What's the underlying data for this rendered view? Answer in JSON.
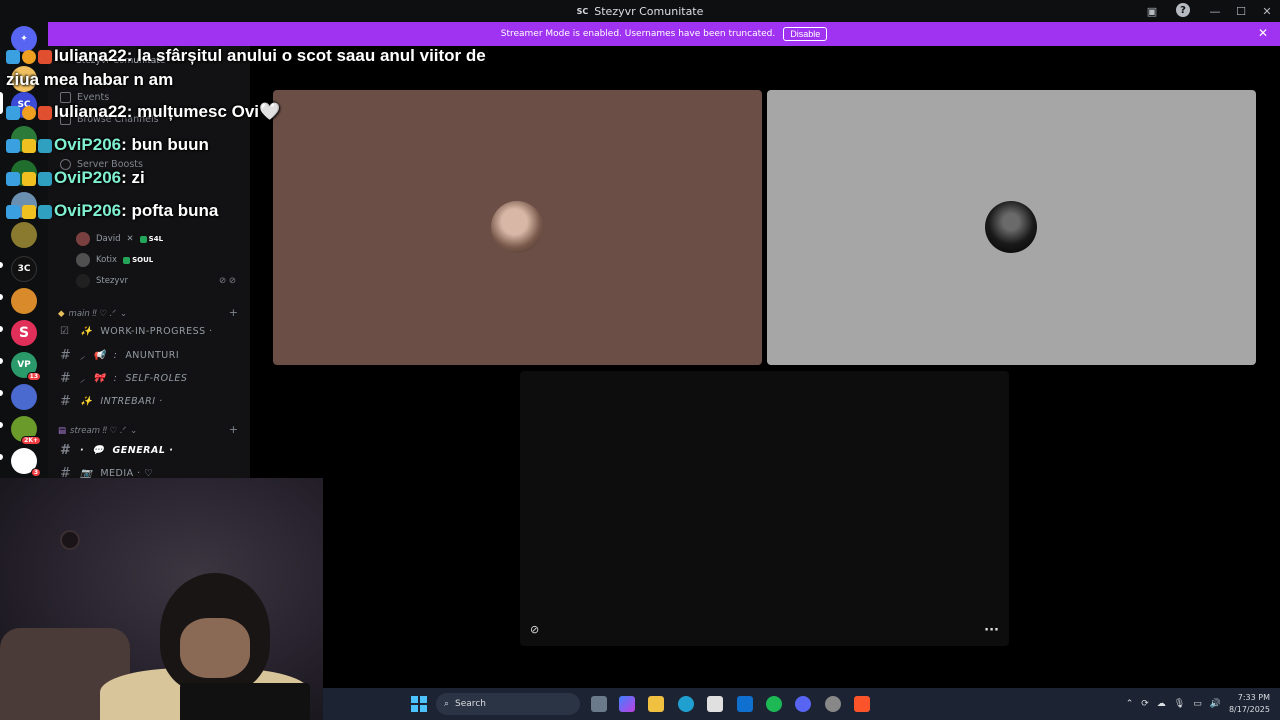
{
  "window": {
    "title": "Stezyvr Comunitate",
    "icon_text": "SC",
    "controls": [
      "minimize-icon",
      "maximize-icon",
      "close-icon"
    ]
  },
  "banner": {
    "message": "Streamer Mode is enabled. Usernames have been truncated.",
    "disable_label": "Disable",
    "color": "#a033f2"
  },
  "server_rail": {
    "items": [
      {
        "label": "",
        "icon": "discord-icon",
        "color": "#5865f2"
      },
      {
        "label": "",
        "badge": "",
        "color": "#f0c060"
      },
      {
        "label": "SC",
        "badge": "",
        "color": "#3b4bd8"
      },
      {
        "label": "",
        "badge": "",
        "color": "#2b7a3a"
      },
      {
        "label": "",
        "badge": "",
        "color": "#1f6e2e"
      },
      {
        "label": "",
        "badge": "",
        "color": "#6b8fb0"
      },
      {
        "label": "",
        "badge": "",
        "color": "#8a7a30"
      },
      {
        "label": "3C",
        "badge": "",
        "color": "#111111"
      },
      {
        "label": "",
        "badge": "",
        "color": "#d98a2a"
      },
      {
        "label": "S",
        "badge": "",
        "color": "#e0305a"
      },
      {
        "label": "VP",
        "badge": "13",
        "color": "#2a9a6a"
      },
      {
        "label": "",
        "badge": "",
        "color": "#4a6ad0"
      },
      {
        "label": "",
        "badge": "2K+",
        "color": "#6a9a2a"
      },
      {
        "label": "",
        "badge": "3",
        "color": "#ffffff"
      }
    ]
  },
  "sidebar": {
    "server_name": "Stezyvr Comunitate",
    "menu": [
      {
        "label": "Events",
        "icon": "calendar-icon"
      },
      {
        "label": "Browse Channels",
        "icon": "browse-icon"
      },
      {
        "label": "Server Boosts",
        "icon": "boost-icon"
      }
    ],
    "voice_users": [
      {
        "name": "David",
        "tag": "S4L",
        "color": "#7a4040"
      },
      {
        "name": "Kotix",
        "tag": "SOUL",
        "color": "#505050"
      },
      {
        "name": "Stezyvr",
        "tag": "",
        "color": "#202020"
      }
    ],
    "categories": [
      {
        "name": "main ‼ ♡ .ᐟ",
        "channels": [
          {
            "name": "WORK-IN-PROGRESS ·",
            "emoji": "✨",
            "icon": "check-icon"
          },
          {
            "name": "ANUNTURI",
            "emoji": "📢",
            "icon": "hash-icon"
          },
          {
            "name": "SELF-ROLES",
            "emoji": "🎀",
            "icon": "hash-icon"
          },
          {
            "name": "INTREBARI ·",
            "emoji": "✨",
            "icon": "hash-icon"
          }
        ]
      },
      {
        "name": "stream ‼ ♡ .ᐟ",
        "channels": [
          {
            "name": "GENERAL ·",
            "emoji": "💬",
            "icon": "hash-icon",
            "active": true
          },
          {
            "name": "MEDIA · ♡",
            "emoji": "📷",
            "icon": "hash-icon"
          }
        ]
      }
    ]
  },
  "chat_overlay": [
    {
      "user": "Iuliana22",
      "message": "la sfârșitul anului o scot saau anul viitor de",
      "style": "iuliana"
    },
    {
      "user": "",
      "message": "ziua mea habar n am",
      "style": "cont"
    },
    {
      "user": "Iuliana22",
      "message": "mulțumesc Ovi🤍",
      "style": "iuliana"
    },
    {
      "user": "OviP206",
      "message": "bun buun",
      "style": "ovi"
    },
    {
      "user": "OviP206",
      "message": "zi",
      "style": "ovi"
    },
    {
      "user": "OviP206",
      "message": "pofta buna",
      "style": "ovi"
    }
  ],
  "taskbar": {
    "search_placeholder": "Search",
    "time": "7:33 PM",
    "date": "8/17/2025",
    "apps": [
      "file-explorer-icon",
      "copilot-icon",
      "folder-icon",
      "edge-icon",
      "store-icon",
      "outlook-icon",
      "spotify-icon",
      "discord-icon",
      "chrome-icon",
      "brave-icon"
    ]
  }
}
